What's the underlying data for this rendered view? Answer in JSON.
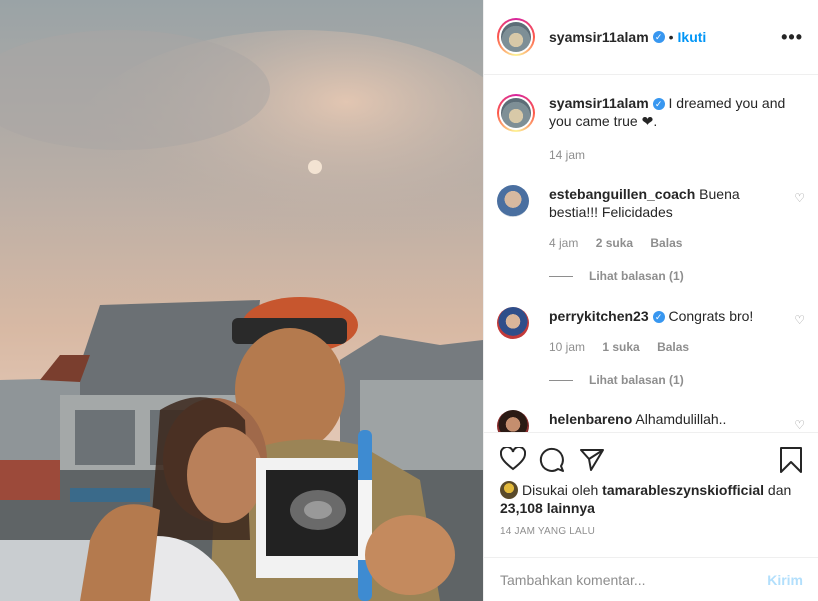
{
  "header": {
    "username": "syamsir11alam",
    "separator": "•",
    "follow_label": "Ikuti",
    "more_label": "•••"
  },
  "caption": {
    "username": "syamsir11alam",
    "text": "I dreamed you and you came true ❤.",
    "time": "14 jam"
  },
  "comments": [
    {
      "username": "estebanguillen_coach",
      "text": "Buena bestia!!! Felicidades",
      "time": "4 jam",
      "likes": "2 suka",
      "reply_label": "Balas",
      "view_replies": "Lihat balasan (1)"
    },
    {
      "username": "perrykitchen23",
      "verified": true,
      "text": "Congrats bro!",
      "time": "10 jam",
      "likes": "1 suka",
      "reply_label": "Balas",
      "view_replies": "Lihat balasan (1)"
    },
    {
      "username": "helenbareno",
      "text": "Alhamdulillah.."
    }
  ],
  "likes": {
    "prefix": "Disukai oleh",
    "user": "tamarableszynskiofficial",
    "conj": "dan",
    "count": "23,108 lainnya"
  },
  "timeago": "14 JAM YANG LALU",
  "add_comment": {
    "placeholder": "Tambahkan komentar...",
    "post_label": "Kirim"
  },
  "icons": {
    "like": "heart-icon",
    "comment": "comment-icon",
    "share": "share-icon",
    "save": "bookmark-icon",
    "verified": "verified-badge-icon"
  },
  "colors": {
    "accent": "#0095f6",
    "verified": "#3897f0",
    "muted": "#8e8e8e",
    "post_disabled": "#b2dffc"
  }
}
